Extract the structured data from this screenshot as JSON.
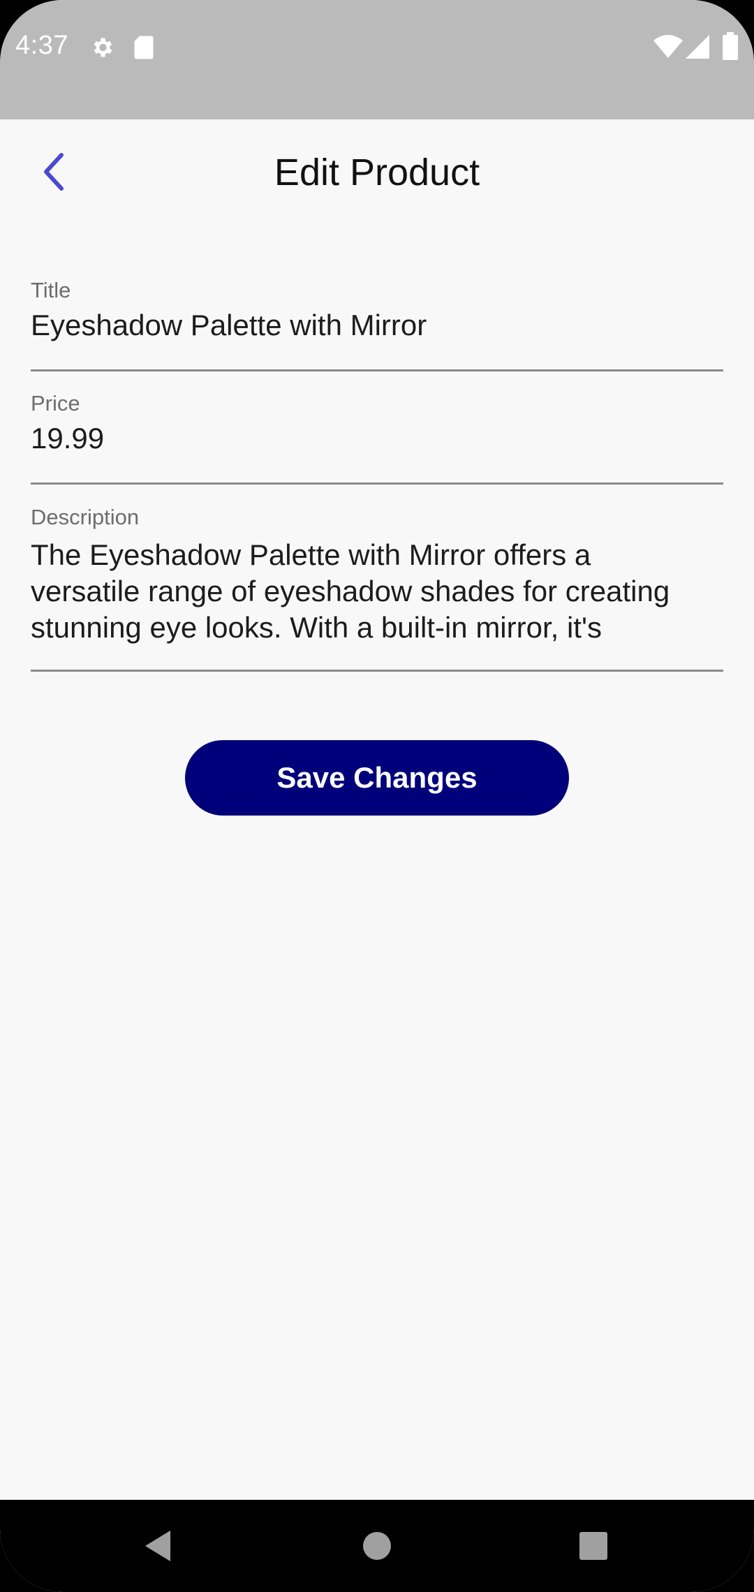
{
  "status_bar": {
    "time": "4:37",
    "left_icons": [
      "gear-icon",
      "sd-card-icon"
    ],
    "right_icons": [
      "wifi-icon",
      "cell-signal-icon",
      "battery-icon"
    ]
  },
  "app_bar": {
    "title": "Edit Product",
    "back_icon": "chevron-left-icon",
    "accent_color": "#4a4ad0"
  },
  "form": {
    "title": {
      "label": "Title",
      "value": "Eyeshadow Palette with Mirror"
    },
    "price": {
      "label": "Price",
      "value": "19.99"
    },
    "description": {
      "label": "Description",
      "value": "The Eyeshadow Palette with Mirror offers a\nversatile range of eyeshadow shades for creating\nstunning eye looks. With a built-in mirror, it's"
    }
  },
  "save_button": {
    "label": "Save Changes",
    "color": "#00007a"
  },
  "nav_bar": {
    "buttons": [
      "back-triangle-icon",
      "home-circle-icon",
      "recents-square-icon"
    ]
  }
}
